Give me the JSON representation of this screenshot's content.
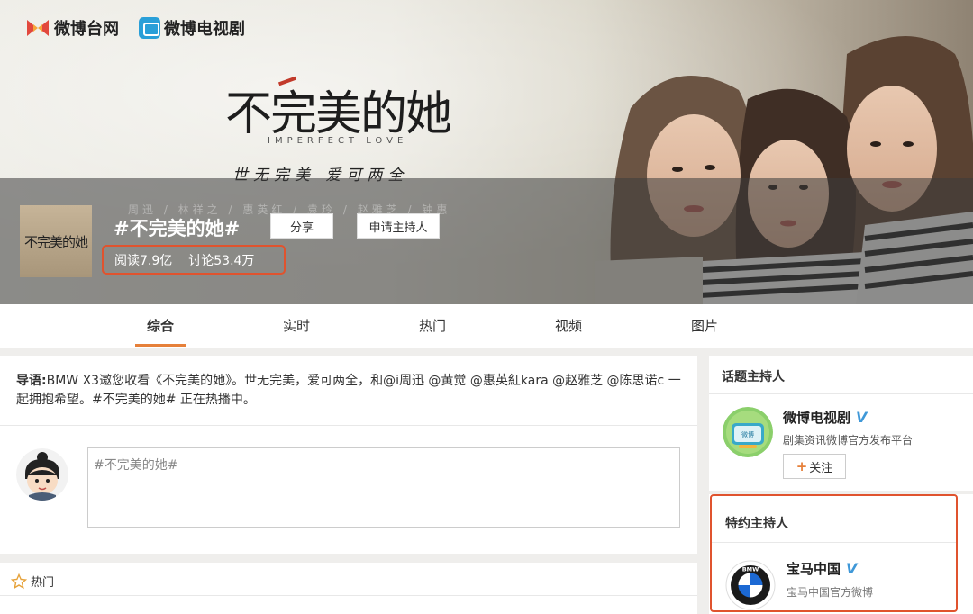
{
  "brand": {
    "weibo_tai": "微博台网",
    "weibo_tv": "微博电视剧"
  },
  "poster": {
    "title": "不完美的她",
    "subtitle_en": "IMPERFECT LOVE",
    "tagline": "世无完美 爱可两全",
    "cast_faded": "周迅 / 林祥之 / 惠英红 / 袁玲 / 赵雅芝 / 钟惠"
  },
  "topic": {
    "thumb_text": "不完美的她",
    "title": "#不完美的她#",
    "share_label": "分享",
    "apply_label": "申请主持人",
    "reads": "阅读7.9亿",
    "discussions": "讨论53.4万"
  },
  "tabs": [
    "综合",
    "实时",
    "热门",
    "视频",
    "图片"
  ],
  "intro": {
    "label": "导语:",
    "text": "BMW X3邀您收看《不完美的她》。世无完美，爱可两全，和@i周迅 @黄觉 @惠英紅kara @赵雅芝 @陈思诺c 一起拥抱希望。#不完美的她# 正在热播中。"
  },
  "compose": {
    "placeholder": "#不完美的她#"
  },
  "hot": {
    "label": "热门"
  },
  "sidebar": {
    "host_title": "话题主持人",
    "host": {
      "name": "微博电视剧",
      "desc": "剧集资讯微博官方发布平台",
      "follow_label": "关注",
      "avatar_text": "微博电视剧"
    },
    "sponsor_title": "特约主持人",
    "sponsor": {
      "name": "宝马中国",
      "desc": "宝马中国官方微博",
      "logo_text": "BMW"
    }
  },
  "colors": {
    "accent_orange": "#e6803a",
    "highlight_red": "#e0532e",
    "verified_blue": "#3f98d8"
  }
}
